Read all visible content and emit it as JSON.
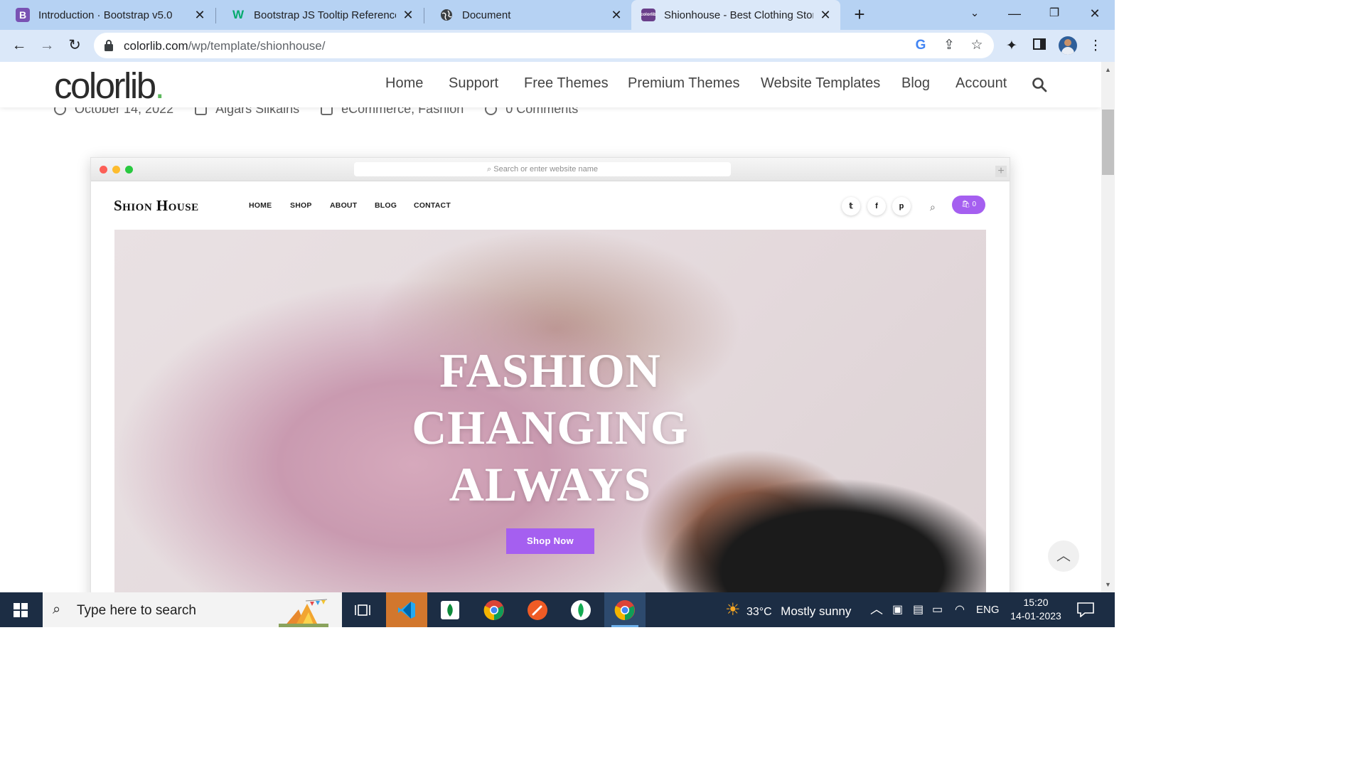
{
  "browser": {
    "tabs": [
      {
        "title": "Introduction · Bootstrap v5.0",
        "icon": "bootstrap-icon",
        "active": false
      },
      {
        "title": "Bootstrap JS Tooltip Reference",
        "icon": "w3schools-icon",
        "active": false
      },
      {
        "title": "Document",
        "icon": "globe-icon",
        "active": false
      },
      {
        "title": "Shionhouse - Best Clothing Store",
        "icon": "colorlib-icon",
        "active": true
      }
    ],
    "url_host": "colorlib.com",
    "url_path": "/wp/template/shionhouse/"
  },
  "site": {
    "logo_text": "colorlib",
    "logo_dot": ".",
    "nav": [
      "Home",
      "Support",
      "Free Themes",
      "Premium Themes",
      "Website Templates",
      "Blog",
      "Account"
    ],
    "meta": {
      "date": "October 14, 2022",
      "author": "Aigars Silkalns",
      "categories": "eCommerce, Fashion",
      "comments": "0 Comments"
    }
  },
  "mockup": {
    "address_placeholder": "Search or enter website name",
    "brand": "Shion House",
    "nav": [
      "HOME",
      "SHOP",
      "ABOUT",
      "BLOG",
      "CONTACT"
    ],
    "social": [
      "twitter-icon",
      "facebook-icon",
      "pinterest-icon"
    ],
    "cart_count": "0",
    "hero_lines": [
      "FASHION",
      "CHANGING",
      "ALWAYS"
    ],
    "cta": "Shop Now",
    "accent": "#a55ff0"
  },
  "taskbar": {
    "search_placeholder": "Type here to search",
    "weather_temp": "33°C",
    "weather_desc": "Mostly sunny",
    "language": "ENG",
    "time": "15:20",
    "date": "14-01-2023"
  }
}
